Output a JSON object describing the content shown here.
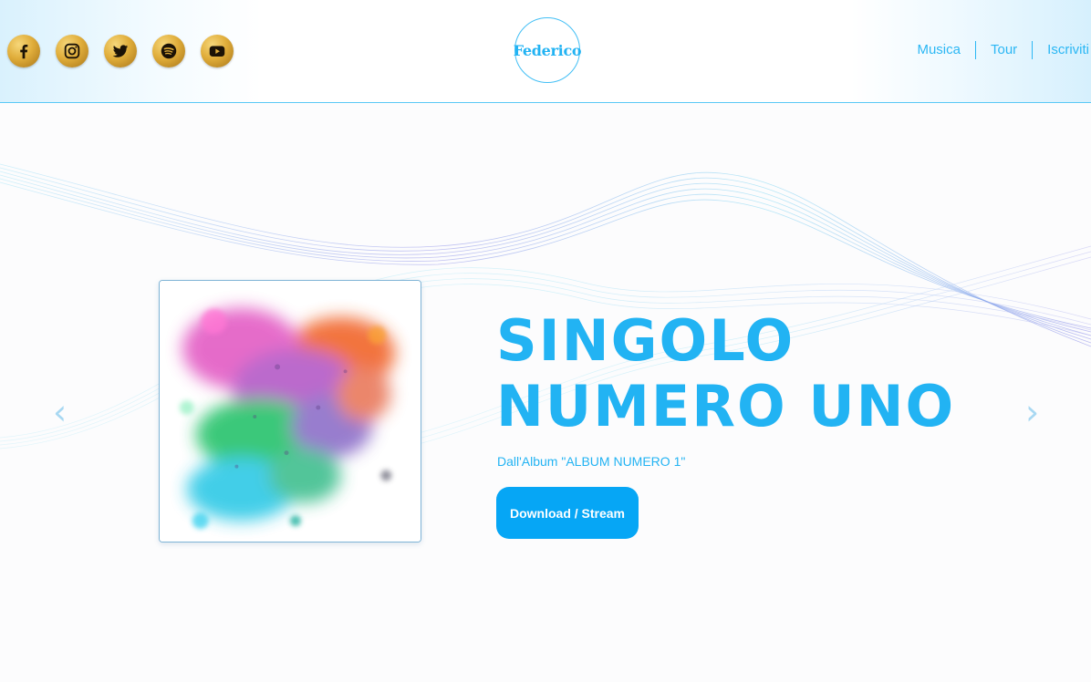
{
  "header": {
    "socials": [
      {
        "name": "facebook",
        "icon": "facebook-icon"
      },
      {
        "name": "instagram",
        "icon": "instagram-icon"
      },
      {
        "name": "twitter",
        "icon": "twitter-icon"
      },
      {
        "name": "spotify",
        "icon": "spotify-icon"
      },
      {
        "name": "youtube",
        "icon": "youtube-icon"
      }
    ],
    "logo_text": "Federico",
    "nav": [
      "Musica",
      "Tour",
      "Iscriviti"
    ]
  },
  "hero": {
    "title_line1": "SINGOLO",
    "title_line2": "NUMERO UNO",
    "subtitle": "Dall'Album \"ALBUM NUMERO 1\"",
    "cta_label": "Download / Stream",
    "prev_arrow": "‹",
    "next_arrow": "›",
    "cover_image": "watercolor-splash-artwork"
  },
  "colors": {
    "accent": "#22b3f3",
    "button": "#06a6f5",
    "social_gold": "#e0ad3a",
    "wave_purple": "#8f8fe8",
    "wave_cyan": "#7fd7f2"
  }
}
